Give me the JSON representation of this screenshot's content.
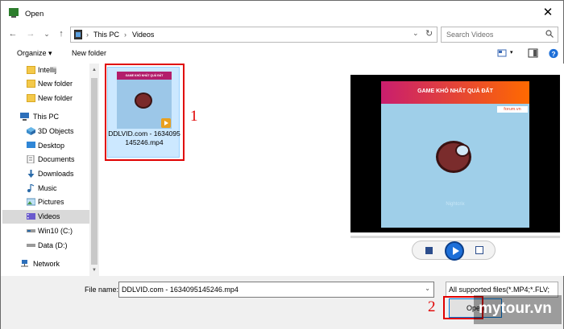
{
  "window": {
    "title": "Open",
    "close_glyph": "✕"
  },
  "nav": {
    "back_glyph": "←",
    "forward_glyph": "→",
    "recent_glyph": "⌄",
    "up_glyph": "↑",
    "breadcrumb": [
      "This PC",
      "Videos"
    ],
    "separator": "›",
    "dropdown_glyph": "⌄",
    "refresh_glyph": "↻",
    "search_placeholder": "Search Videos"
  },
  "toolbar": {
    "organize_label": "Organize ▾",
    "new_folder_label": "New folder",
    "view_glyph": "▾"
  },
  "sidebar": {
    "items": [
      {
        "label": "Intellij",
        "icon": "folder-icon"
      },
      {
        "label": "New folder",
        "icon": "folder-icon"
      },
      {
        "label": "New folder",
        "icon": "folder-icon"
      },
      {
        "label": "This PC",
        "icon": "computer-icon"
      },
      {
        "label": "3D Objects",
        "icon": "cube-icon"
      },
      {
        "label": "Desktop",
        "icon": "desktop-icon"
      },
      {
        "label": "Documents",
        "icon": "document-icon"
      },
      {
        "label": "Downloads",
        "icon": "download-icon"
      },
      {
        "label": "Music",
        "icon": "music-icon"
      },
      {
        "label": "Pictures",
        "icon": "picture-icon"
      },
      {
        "label": "Videos",
        "icon": "video-icon",
        "selected": true
      },
      {
        "label": "Win10 (C:)",
        "icon": "drive-icon"
      },
      {
        "label": "Data (D:)",
        "icon": "drive-icon"
      },
      {
        "label": "Network",
        "icon": "network-icon"
      }
    ]
  },
  "files": [
    {
      "name": "DDLVID.com - 1634095145246.mp4",
      "thumb_title": "GAME KHÓ NHẤT QUẢ ĐẤT"
    }
  ],
  "preview": {
    "video_title": "GAME KHÓ NHẤT QUẢ ĐẤT",
    "forum_badge": "forum.vn",
    "watermark": "Nightcrix"
  },
  "footer": {
    "file_name_label": "File name:",
    "file_name_value": "DDLVID.com - 1634095145246.mp4",
    "file_type_value": "All supported files(*.MP4;*.FLV;",
    "open_label": "Open",
    "dropdown_glyph": "⌄"
  },
  "annotations": {
    "step1": "1",
    "step2": "2",
    "color": "#e00000"
  },
  "watermark_logo": "mytour.vn"
}
